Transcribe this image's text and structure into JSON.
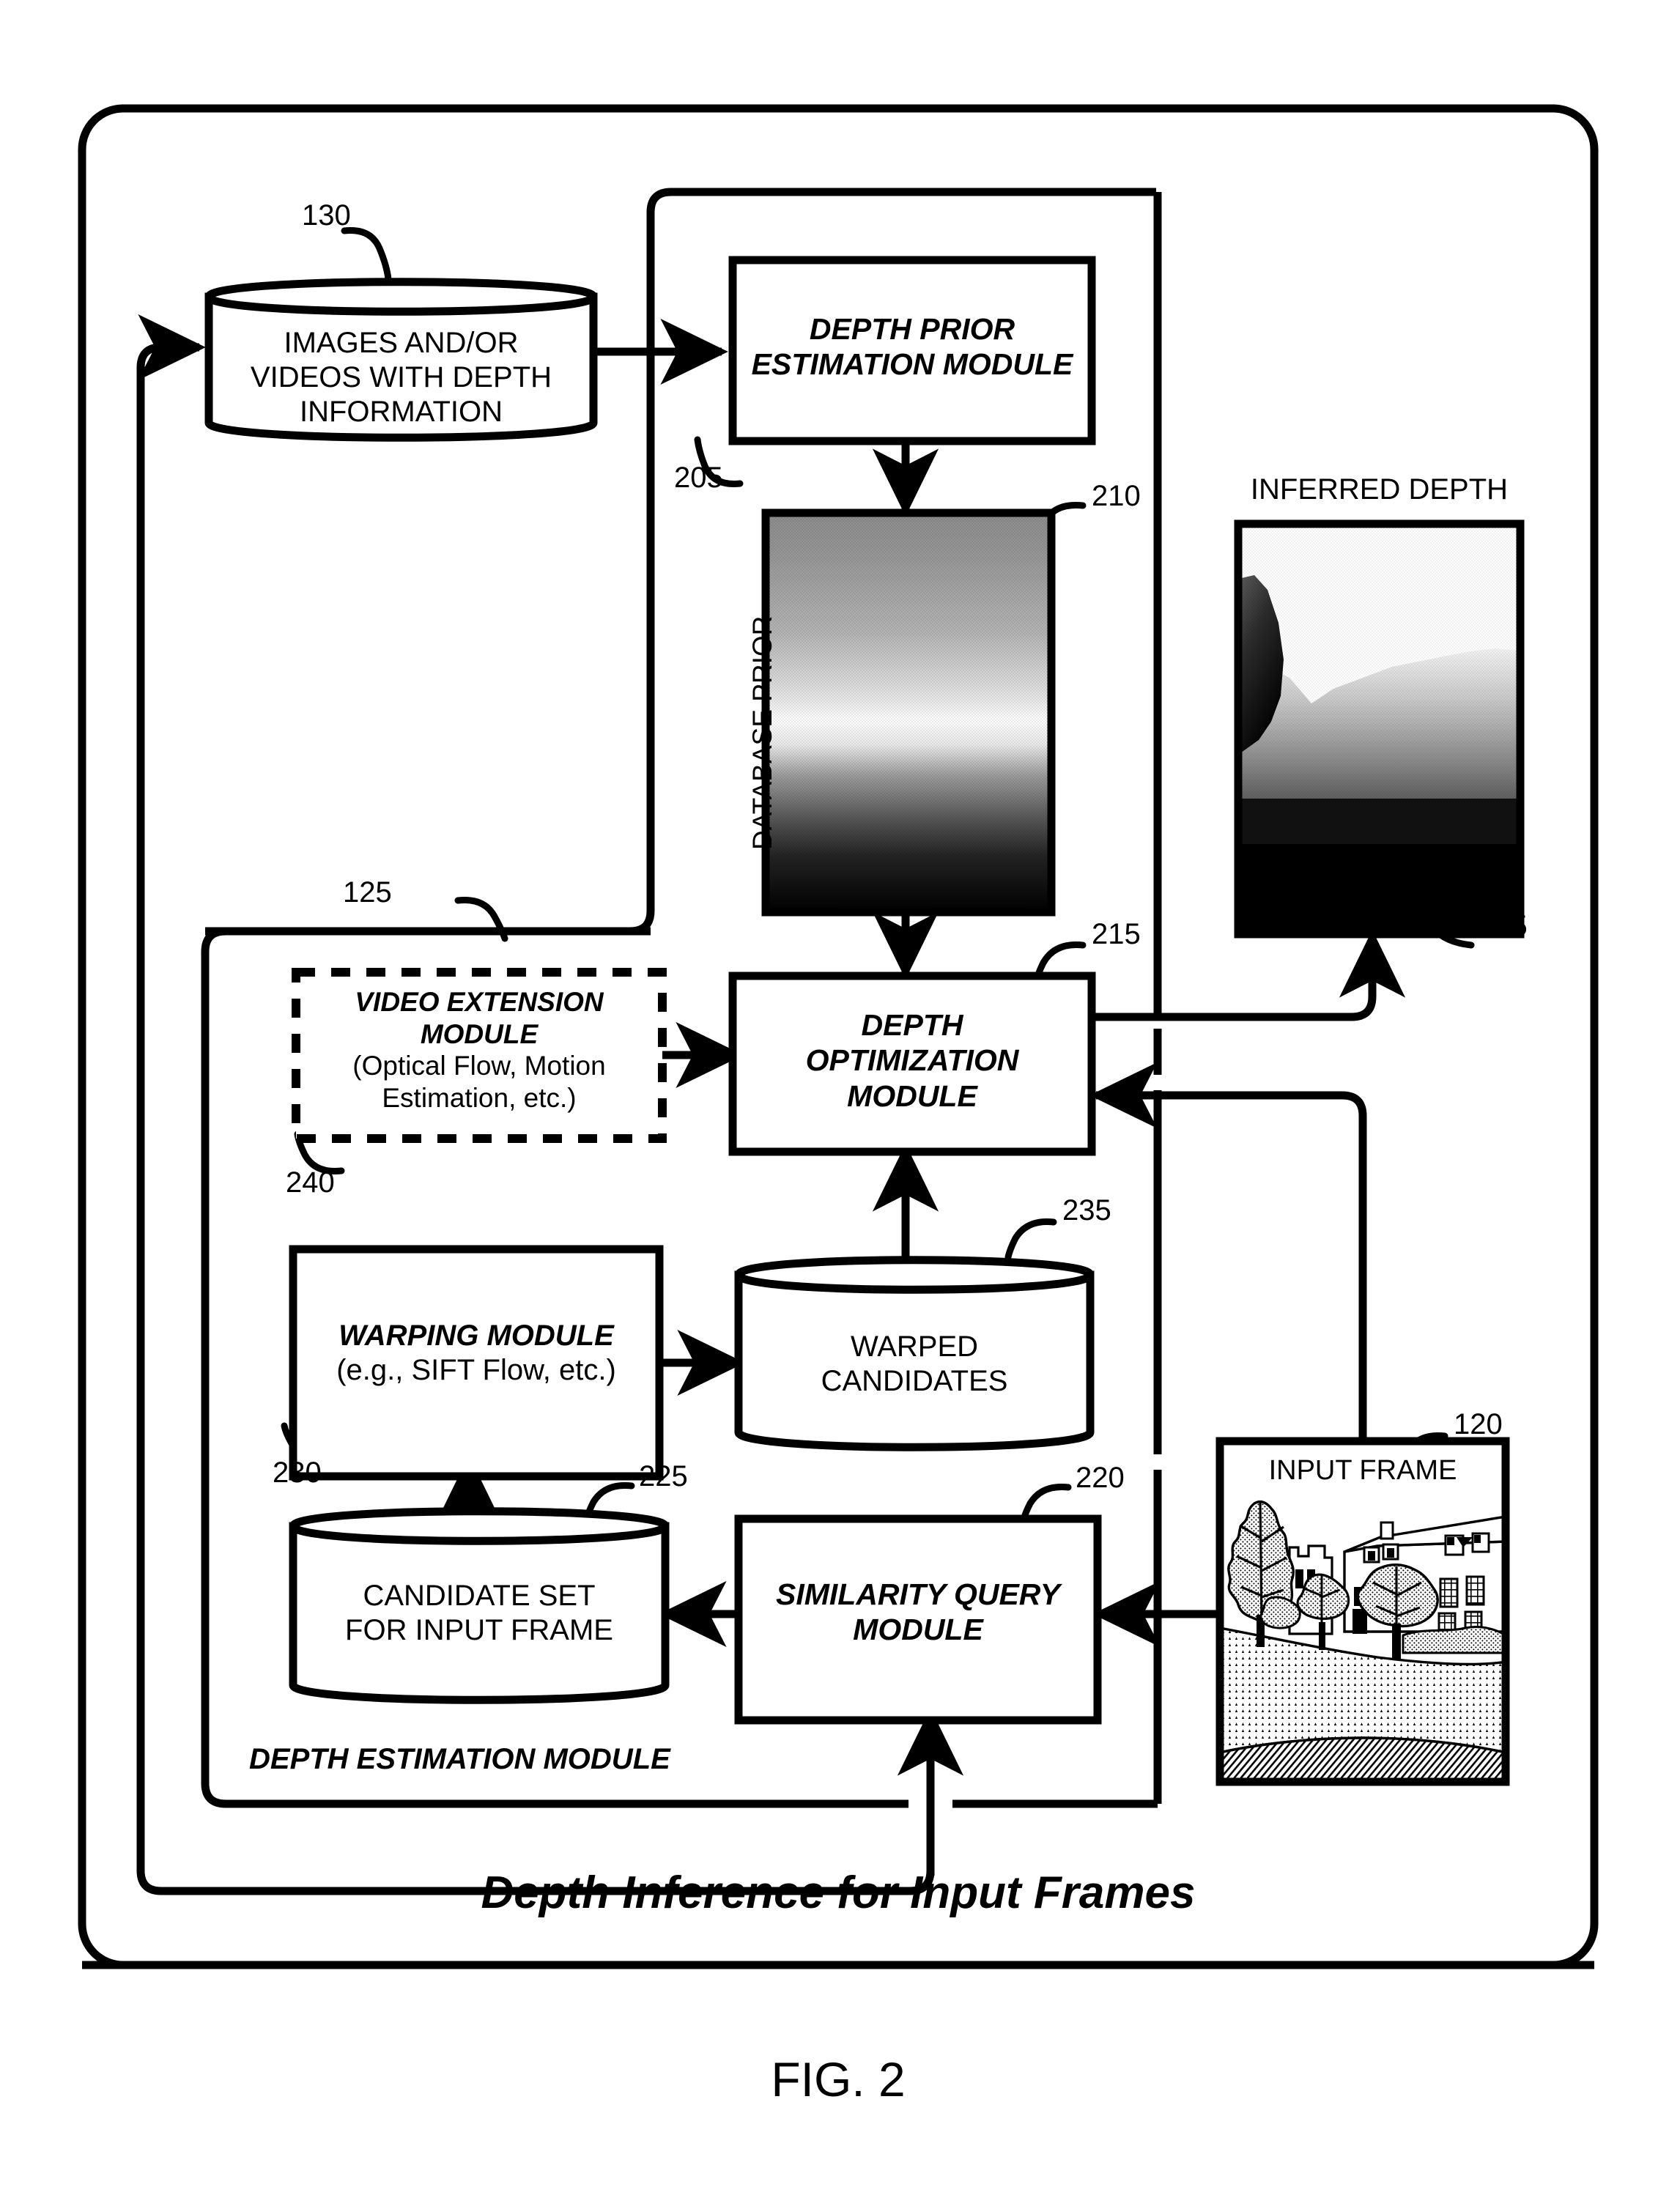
{
  "figure": {
    "caption": "FIG. 2",
    "title": "Depth Inference for Input Frames"
  },
  "nodes": {
    "database_store": {
      "label_lines": [
        "IMAGES AND/OR",
        "VIDEOS WITH DEPTH",
        "INFORMATION"
      ],
      "ref": "130",
      "shape": "cylinder"
    },
    "depth_prior_estimation": {
      "label_lines": [
        "DEPTH PRIOR",
        "ESTIMATION MODULE"
      ],
      "ref": "205",
      "shape": "box"
    },
    "database_prior_image": {
      "side_label": "DATABASE PRIOR",
      "ref": "210",
      "shape": "image"
    },
    "inferred_depth_image": {
      "label": "INFERRED DEPTH",
      "ref": "135",
      "shape": "image"
    },
    "depth_estimation_module": {
      "label": "DEPTH ESTIMATION MODULE",
      "ref": "125",
      "shape": "rounded-container"
    },
    "video_extension": {
      "label_lines_bold": [
        "VIDEO EXTENSION",
        "MODULE"
      ],
      "label_lines_plain": [
        "(Optical Flow, Motion",
        "Estimation, etc.)"
      ],
      "ref": "240",
      "shape": "dashed-box"
    },
    "depth_optimization": {
      "label_lines": [
        "DEPTH",
        "OPTIMIZATION",
        "MODULE"
      ],
      "ref": "215",
      "shape": "box"
    },
    "warping_module": {
      "label_lines_bold": [
        "WARPING MODULE"
      ],
      "label_lines_plain": [
        "(e.g., SIFT Flow, etc.)"
      ],
      "ref": "230",
      "shape": "box"
    },
    "warped_candidates": {
      "label_lines": [
        "WARPED",
        "CANDIDATES"
      ],
      "ref": "235",
      "shape": "cylinder"
    },
    "candidate_set": {
      "label_lines": [
        "CANDIDATE SET",
        "FOR INPUT FRAME"
      ],
      "ref": "225",
      "shape": "cylinder"
    },
    "similarity_query": {
      "label_lines": [
        "SIMILARITY QUERY",
        "MODULE"
      ],
      "ref": "220",
      "shape": "box"
    },
    "input_frame": {
      "label": "INPUT FRAME",
      "ref": "120",
      "shape": "image"
    }
  },
  "colors": {
    "stroke": "#000000",
    "background": "#ffffff"
  }
}
